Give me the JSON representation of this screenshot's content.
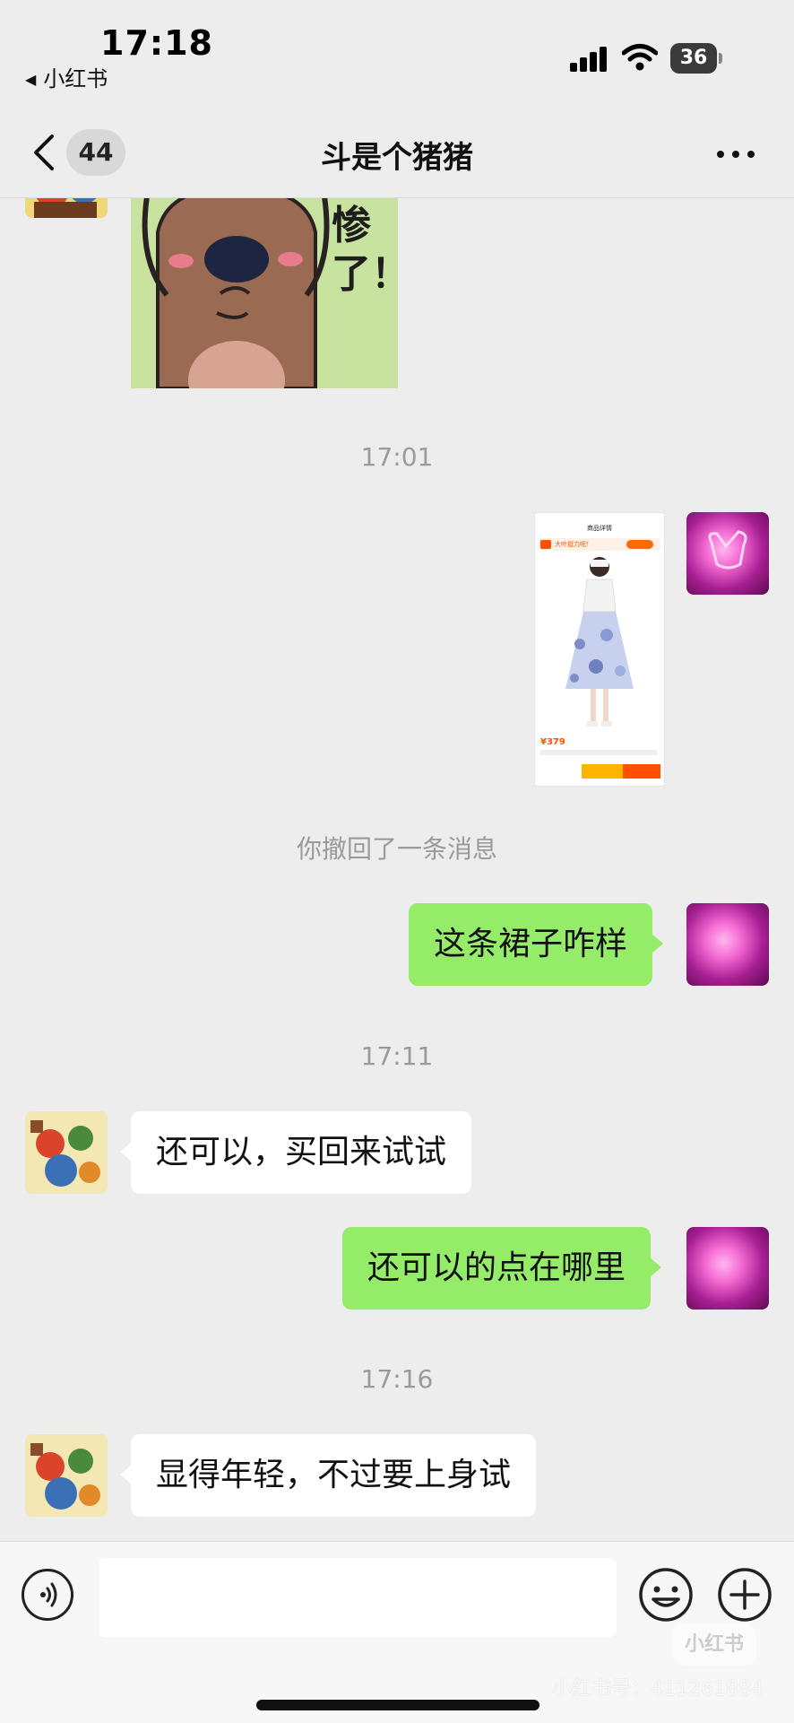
{
  "status_bar": {
    "time": "17:18",
    "back_app_label": "小红书",
    "battery": "36"
  },
  "header": {
    "unread_count": "44",
    "title": "斗是个猪猪"
  },
  "sticker": {
    "text": "惨了！"
  },
  "messages": {
    "ts1": "17:01",
    "recall_notice": "你撤回了一条消息",
    "msg_me_1": "这条裙子咋样",
    "ts2": "17:11",
    "msg_other_1": "还可以，买回来试试",
    "msg_me_2": "还可以的点在哪里",
    "ts3": "17:16",
    "msg_other_2": "显得年轻，不过要上身试"
  },
  "product_screenshot": {
    "page_title": "商品详情",
    "banner_text": "大叶挺力呢！",
    "price": "¥379"
  },
  "input": {
    "placeholder": ""
  },
  "watermark": {
    "logo": "小红书",
    "id_text": "小红书号：411261884"
  },
  "colors": {
    "my_bubble": "#95ec69",
    "other_bubble": "#ffffff",
    "background": "#ededed"
  }
}
